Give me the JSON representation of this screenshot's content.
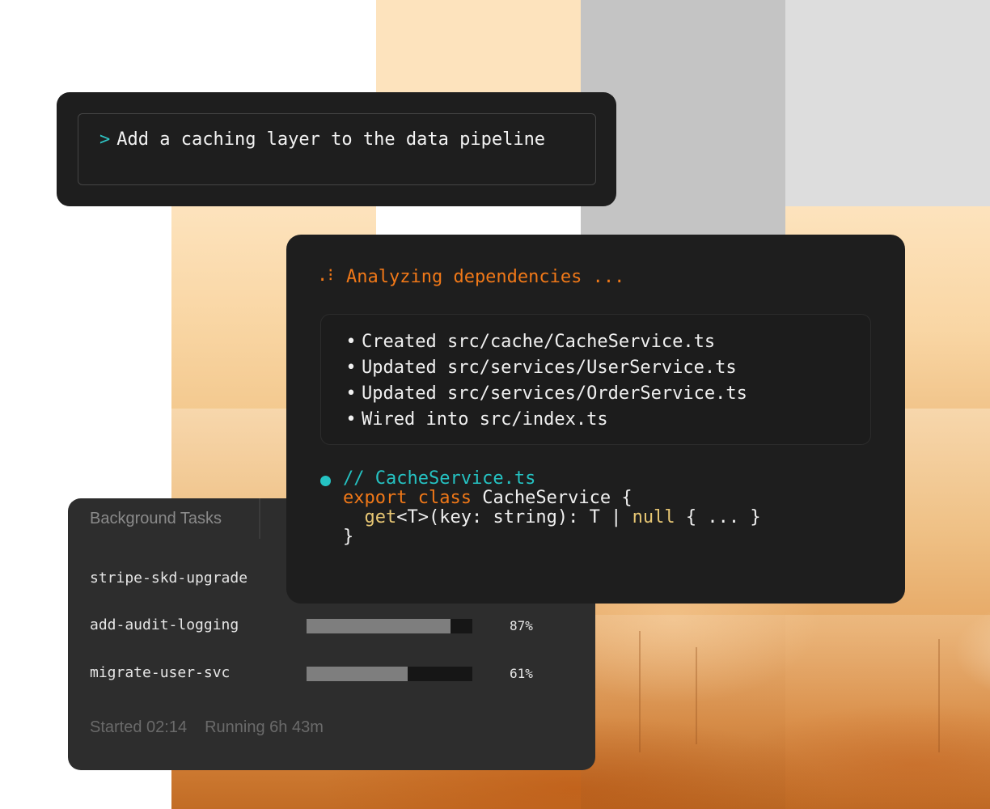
{
  "prompt": {
    "caret": ">",
    "text": "Add a caching layer to the data pipeline"
  },
  "analysis": {
    "spinner_glyph": ".⁝",
    "status": "Analyzing dependencies ...",
    "changes": [
      "Created src/cache/CacheService.ts",
      "Updated src/services/UserService.ts",
      "Updated src/services/OrderService.ts",
      "Wired into src/index.ts"
    ],
    "code": {
      "comment": "// CacheService.ts",
      "line1_kw": "export class",
      "line1_rest": " CacheService {",
      "line2_fn": "get",
      "line2_mid": "<T>(key: string): T | ",
      "line2_null": "null",
      "line2_end": " { ... }",
      "line3": "}"
    }
  },
  "tasks": {
    "tab_label": "Background Tasks",
    "items": [
      {
        "name": "stripe-skd-upgrade",
        "progress": null,
        "pct_label": ""
      },
      {
        "name": "add-audit-logging",
        "progress": 0.87,
        "pct_label": "87%"
      },
      {
        "name": "migrate-user-svc",
        "progress": 0.61,
        "pct_label": "61%"
      }
    ],
    "started": "Started 02:14",
    "running": "Running 6h 43m"
  },
  "colors": {
    "accent_orange": "#f07818",
    "accent_teal": "#25c2c2",
    "card_bg": "#1e1e1e"
  }
}
